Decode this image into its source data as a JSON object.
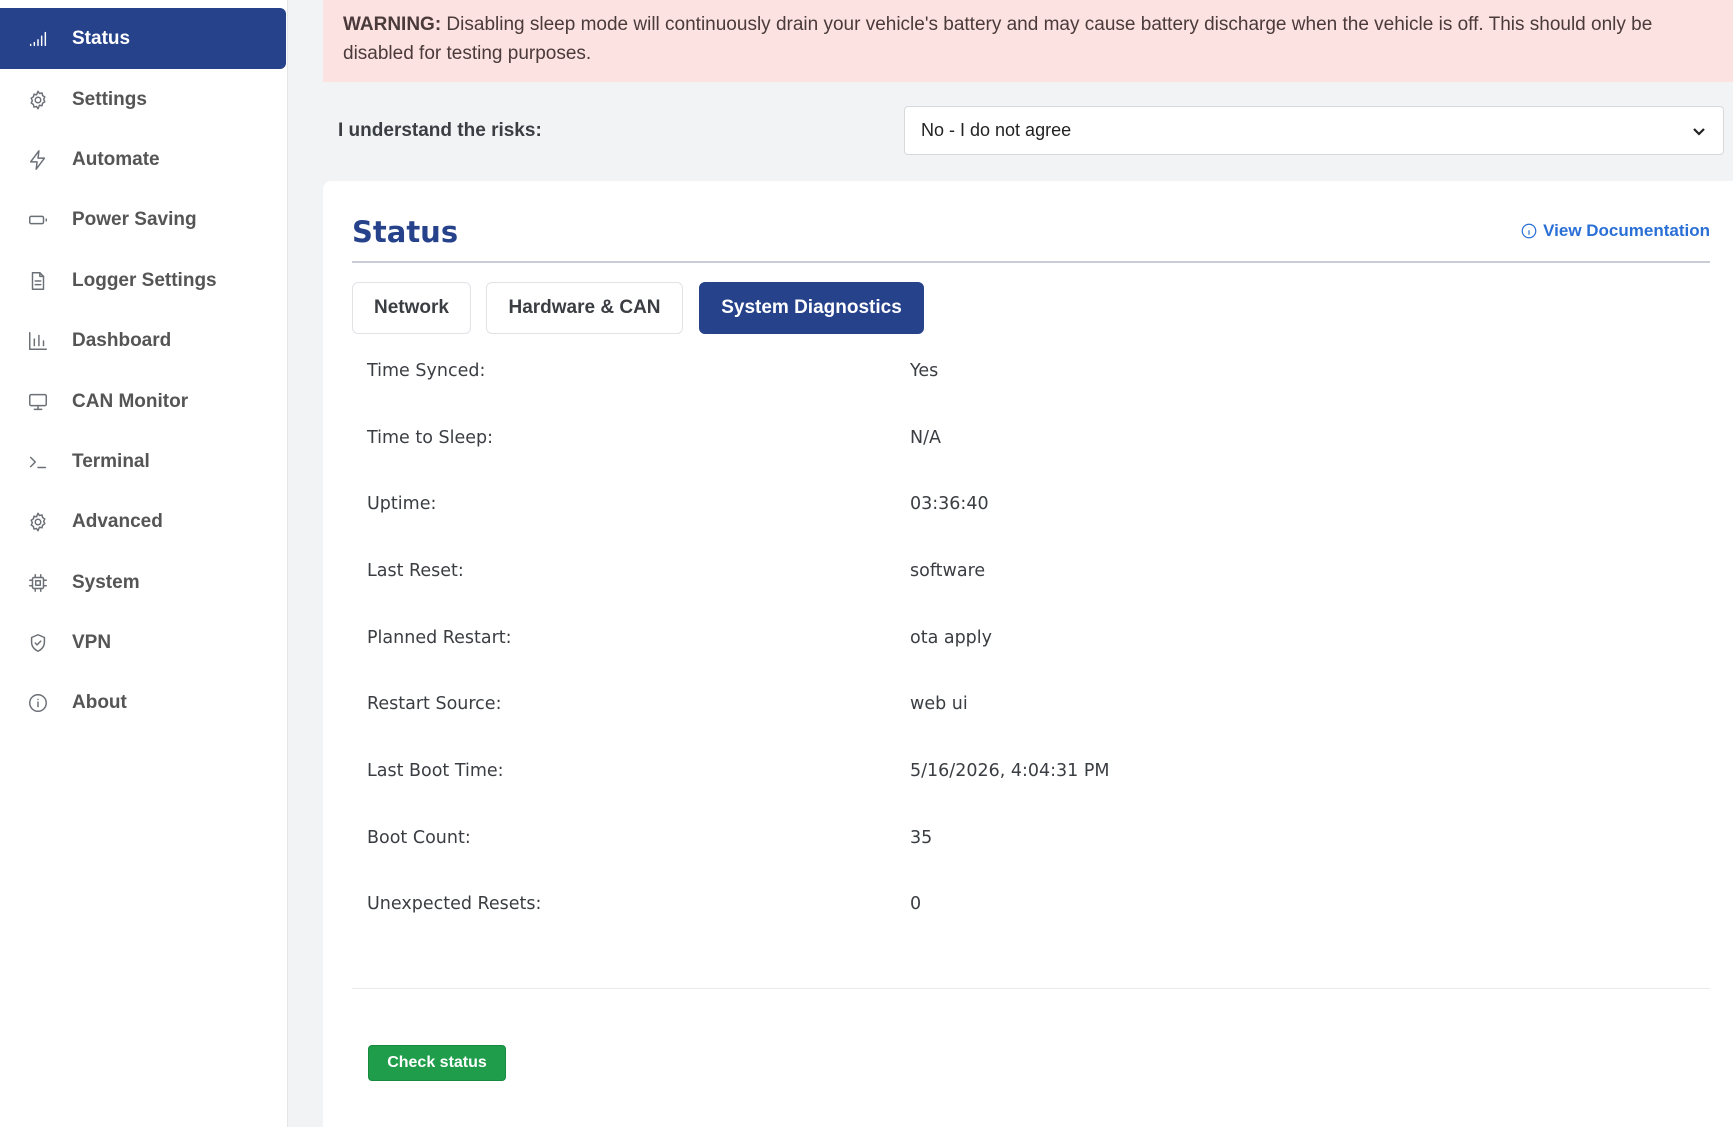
{
  "sidebar": {
    "items": [
      {
        "label": "Status",
        "icon": "signal-icon",
        "active": true
      },
      {
        "label": "Settings",
        "icon": "gear-icon"
      },
      {
        "label": "Automate",
        "icon": "lightning-icon"
      },
      {
        "label": "Power Saving",
        "icon": "battery-icon"
      },
      {
        "label": "Logger Settings",
        "icon": "document-icon"
      },
      {
        "label": "Dashboard",
        "icon": "bar-chart-icon"
      },
      {
        "label": "CAN Monitor",
        "icon": "monitor-icon"
      },
      {
        "label": "Terminal",
        "icon": "terminal-icon"
      },
      {
        "label": "Advanced",
        "icon": "gear-icon"
      },
      {
        "label": "System",
        "icon": "chip-icon"
      },
      {
        "label": "VPN",
        "icon": "shield-icon"
      },
      {
        "label": "About",
        "icon": "info-icon"
      }
    ]
  },
  "warning": {
    "prefix": "WARNING:",
    "text": " Disabling sleep mode will continuously drain your vehicle's battery and may cause battery discharge when the vehicle is off. This should only be disabled for testing purposes."
  },
  "risk": {
    "label": "I understand the risks:",
    "selected": "No - I do not agree"
  },
  "card": {
    "title": "Status",
    "doc_link": "View Documentation",
    "tabs": [
      {
        "label": "Network"
      },
      {
        "label": "Hardware & CAN"
      },
      {
        "label": "System Diagnostics",
        "active": true
      }
    ],
    "rows": [
      {
        "key": "Time Synced:",
        "value": "Yes"
      },
      {
        "key": "Time to Sleep:",
        "value": "N/A"
      },
      {
        "key": "Uptime:",
        "value": "03:36:40"
      },
      {
        "key": "Last Reset:",
        "value": "software"
      },
      {
        "key": "Planned Restart:",
        "value": "ota apply"
      },
      {
        "key": "Restart Source:",
        "value": "web ui"
      },
      {
        "key": "Last Boot Time:",
        "value": "5/16/2026, 4:04:31 PM"
      },
      {
        "key": "Boot Count:",
        "value": "35"
      },
      {
        "key": "Unexpected Resets:",
        "value": "0"
      }
    ],
    "check_button": "Check status"
  },
  "colors": {
    "primary": "#26428b",
    "link": "#2a6fd6",
    "success": "#1f9d4a",
    "warning_bg": "#fde2e2"
  }
}
